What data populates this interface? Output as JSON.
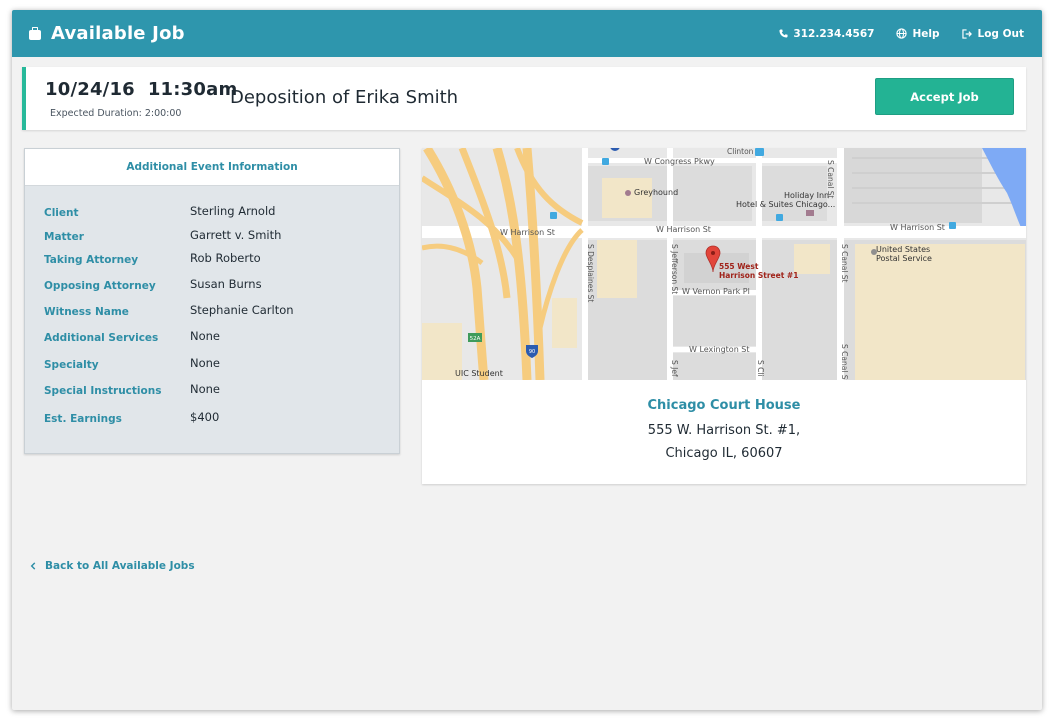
{
  "header": {
    "title": "Available Job",
    "phone": "312.234.4567",
    "help": "Help",
    "logout": "Log Out"
  },
  "job": {
    "datetime": "10/24/16  11:30am",
    "duration": "Expected Duration: 2:00:00",
    "title": "Deposition of Erika Smith",
    "accept_label": "Accept Job"
  },
  "info": {
    "heading": "Additional Event Information",
    "rows": [
      {
        "label": "Client",
        "value": "Sterling Arnold"
      },
      {
        "label": "Matter",
        "value": "Garrett v. Smith"
      },
      {
        "label": "Taking Attorney",
        "value": "Rob Roberto"
      },
      {
        "label": "Opposing Attorney",
        "value": "Susan Burns"
      },
      {
        "label": "Witness Name",
        "value": "Stephanie Carlton"
      },
      {
        "label": "Additional Services",
        "value": "None"
      },
      {
        "label": "Specialty",
        "value": "None"
      },
      {
        "label": "Special Instructions",
        "value": "None"
      },
      {
        "label": "Est. Earnings",
        "value": "$400"
      }
    ]
  },
  "map": {
    "streets": {
      "congress": "W Congress Pkwy",
      "harrison_left": "W Harrison St",
      "harrison_mid": "W Harrison St",
      "harrison_right": "W Harrison St",
      "vernon": "W Vernon Park Pl",
      "lexington": "W Lexington St",
      "desplaines": "S Desplaines St",
      "jefferson": "S Jefferson St",
      "canal": "S Canal St",
      "canal_lower": "S Canal St",
      "canal_top": "S Canal St",
      "clinton": "Clinton",
      "s_jef_low": "S Jef",
      "s_cli_low": "S Cli"
    },
    "places": {
      "greyhound": "Greyhound",
      "holiday1": "Holiday Inn",
      "holiday2": "Hotel & Suites Chicago...",
      "usps1": "United States",
      "usps2": "Postal Service",
      "uic": "UIC Student",
      "pin1": "555 West",
      "pin2": "Harrison Street #1"
    },
    "shields": {
      "exit": "52A",
      "interstate": "90"
    }
  },
  "location": {
    "name": "Chicago Court House",
    "line1": "555 W. Harrison St. #1,",
    "line2": "Chicago IL, 60607"
  },
  "back_label": "Back to All Available Jobs",
  "colors": {
    "topbar": "#2e96ad",
    "accent": "#2e8ea6",
    "accept": "#23b394",
    "highway": "#f6cc7f"
  }
}
